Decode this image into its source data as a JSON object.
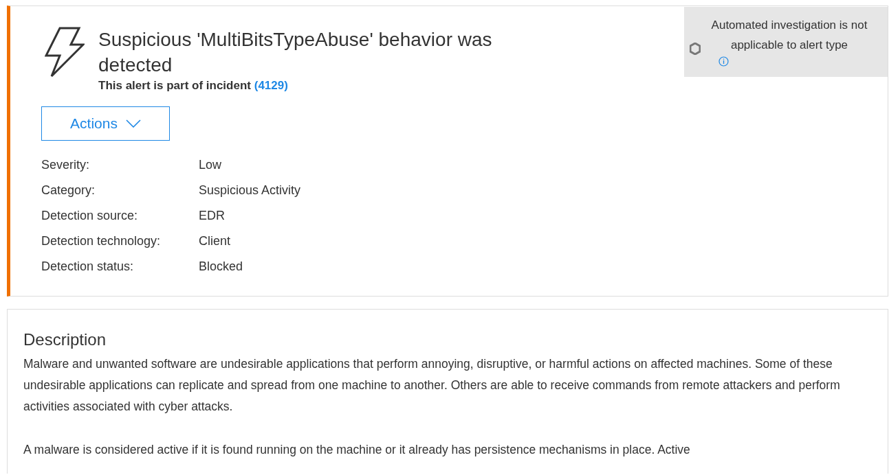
{
  "alert": {
    "title": "Suspicious 'MultiBitsTypeAbuse' behavior was detected",
    "incident_text": "This alert is part of incident",
    "incident_link": "(4129)",
    "actions_button": "Actions",
    "details": [
      {
        "label": "Severity:",
        "value": "Low"
      },
      {
        "label": "Category:",
        "value": "Suspicious Activity"
      },
      {
        "label": "Detection source:",
        "value": "EDR"
      },
      {
        "label": "Detection technology:",
        "value": "Client"
      },
      {
        "label": "Detection status:",
        "value": "Blocked"
      }
    ]
  },
  "investigation": {
    "message": "Automated investigation is not applicable to alert type"
  },
  "description": {
    "heading": "Description",
    "paragraphs": [
      "Malware and unwanted software are undesirable applications that perform annoying, disruptive, or harmful actions on affected machines. Some of these undesirable applications can replicate and spread from one machine to another. Others are able to receive commands from remote attackers and perform activities associated with cyber attacks.",
      "A malware is considered active if it is found running on the machine or it already has persistence mechanisms in place. Active"
    ]
  }
}
